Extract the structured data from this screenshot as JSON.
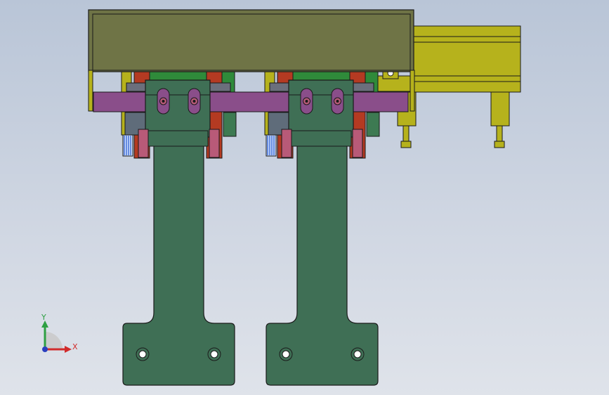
{
  "triad": {
    "y_label": "Y",
    "x_label": "X",
    "y_color": "#2ea043",
    "x_color": "#d12b2b",
    "z_color": "#2a3fbf"
  },
  "colors": {
    "top_plate": "#6e7346",
    "slot_bar": "#8a4e8a",
    "arm": "#3f6f55",
    "red_post": "#b43a22",
    "pink_block": "#b85a78",
    "yellow_part": "#b4b01e",
    "gray_block": "#6b6f7c",
    "green_block": "#2f8a3a",
    "blue_brush": "#3c6fd6",
    "outline": "#1a1a1a"
  },
  "icons": {
    "triad": "axis-triad-icon"
  }
}
